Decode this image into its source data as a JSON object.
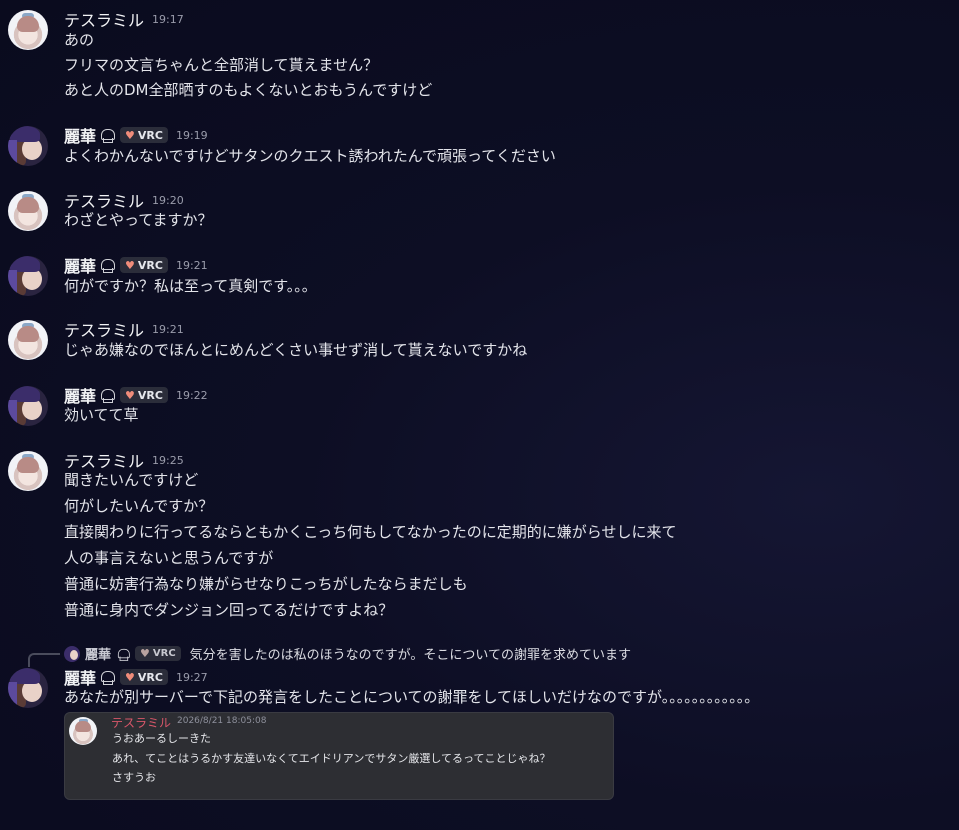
{
  "messages": [
    {
      "name": "テスラミル",
      "time": "19:17",
      "lines": [
        "あの",
        "フリマの文言ちゃんと全部消して貰えません？",
        "あと人のDM全部晒すのもよくないとおもうんですけど"
      ]
    },
    {
      "name": "麗華",
      "tag": "VRC",
      "time": "19:19",
      "lines": [
        "よくわかんないですけどサタンのクエスト誘われたんで頑張ってください"
      ]
    },
    {
      "name": "テスラミル",
      "time": "19:20",
      "lines": [
        "わざとやってますか？"
      ]
    },
    {
      "name": "麗華",
      "tag": "VRC",
      "time": "19:21",
      "lines": [
        "何がですか？私は至って真剣です。。。"
      ]
    },
    {
      "name": "テスラミル",
      "time": "19:21",
      "lines": [
        "じゃあ嫌なのでほんとにめんどくさい事せず消して貰えないですかね"
      ]
    },
    {
      "name": "麗華",
      "tag": "VRC",
      "time": "19:22",
      "lines": [
        "効いてて草"
      ]
    },
    {
      "name": "テスラミル",
      "time": "19:25",
      "lines": [
        "聞きたいんですけど",
        "何がしたいんですか？",
        "直接関わりに行ってるならともかくこっち何もしてなかったのに定期的に嫌がらせしに来て",
        "人の事言えないと思うんですが",
        "普通に妨害行為なり嫌がらせなりこっちがしたならまだしも",
        "普通に身内でダンジョン回ってるだけですよね？"
      ]
    },
    {
      "name": "麗華",
      "tag": "VRC",
      "time": "19:27",
      "lines": [
        "あなたが別サーバーで下記の発言をしたことについての謝罪をしてほしいだけなのですが。。。。。。。。。。。。"
      ]
    }
  ],
  "reply": {
    "name": "麗華",
    "tag": "VRC",
    "text": "気分を害したのは私のほうなのですが。そこについての謝罪を求めています"
  },
  "embed": {
    "name": "テスラミル",
    "timestamp": "2026/8/21 18:05:08",
    "lines": [
      "うおあーるしーきた",
      "あれ、てことはうるかす友達いなくてエイドリアンでサタン厳選してるってことじゃね？",
      "さすうお"
    ]
  }
}
